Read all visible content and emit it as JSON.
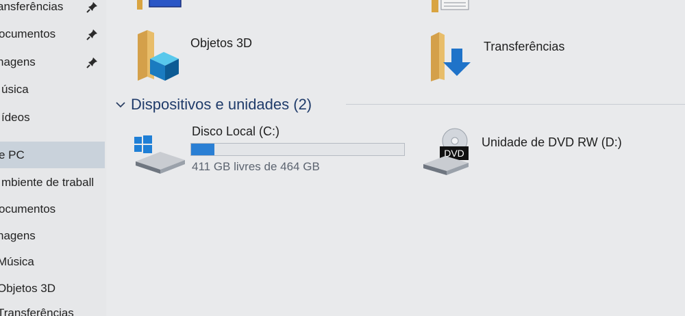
{
  "sidebar": {
    "items": [
      {
        "label": "ansferências",
        "pinned": true
      },
      {
        "label": "ocumentos",
        "pinned": true
      },
      {
        "label": "nagens",
        "pinned": true
      },
      {
        "label": "úsica",
        "pinned": false
      },
      {
        "label": "ídeos",
        "pinned": false
      },
      {
        "label": "e PC",
        "pinned": false,
        "selected": true
      },
      {
        "label": "mbiente de traball",
        "pinned": false
      },
      {
        "label": "ocumentos",
        "pinned": false
      },
      {
        "label": "nagens",
        "pinned": false
      },
      {
        "label": "Música",
        "pinned": false
      },
      {
        "label": "Objetos 3D",
        "pinned": false
      },
      {
        "label": "Transferências",
        "pinned": false
      }
    ]
  },
  "folders": {
    "objects3d": {
      "label": "Objetos 3D",
      "icon": "3d-objects-folder-icon"
    },
    "downloads": {
      "label": "Transferências",
      "icon": "downloads-folder-icon"
    }
  },
  "devices_group": {
    "title": "Dispositivos e unidades (2)",
    "expanded": true
  },
  "drives": {
    "c": {
      "name": "Disco Local (C:)",
      "free_text": "411 GB livres de 464 GB",
      "used_fraction": 0.11,
      "icon": "windows-drive-icon"
    },
    "dvd": {
      "name": "Unidade de DVD RW (D:)",
      "icon": "dvd-drive-icon",
      "badge": "DVD"
    }
  },
  "colors": {
    "accent": "#2a7fd4",
    "group_title": "#1f3b6a",
    "selection": "#c9d2db"
  }
}
